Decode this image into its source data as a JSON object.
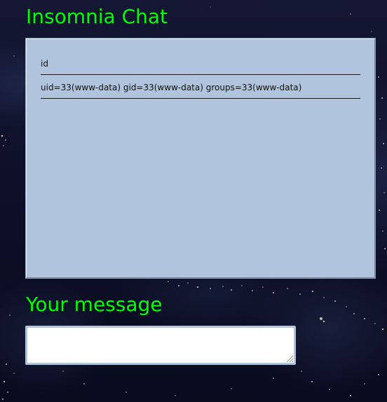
{
  "header": {
    "title": "Insomnia Chat"
  },
  "chat": {
    "messages": [
      {
        "text": "id"
      },
      {
        "text": "uid=33(www-data) gid=33(www-data) groups=33(www-data)"
      }
    ]
  },
  "composer": {
    "heading": "Your message",
    "value": "",
    "placeholder": ""
  },
  "colors": {
    "heading_text": "#00ff00",
    "chat_background": "#b0c4de",
    "page_background": "#0d1028"
  }
}
